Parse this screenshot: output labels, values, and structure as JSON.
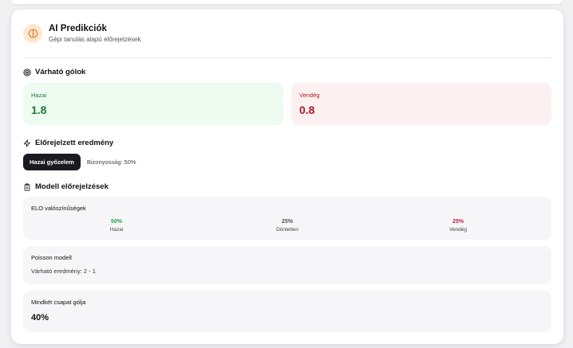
{
  "header": {
    "title": "AI Predikciók",
    "subtitle": "Gépi tanulás alapú előrejelzések",
    "icon": "brain-icon"
  },
  "expected_goals": {
    "title": "Várható gólok",
    "home_label": "Hazai",
    "home_value": "1.8",
    "away_label": "Vendég",
    "away_value": "0.8"
  },
  "predicted_result": {
    "title": "Előrejelzett eredmény",
    "outcome": "Hazai győzelem",
    "confidence": "Bizonyosság: 50%"
  },
  "model_predictions": {
    "title": "Modell előrejelzések",
    "elo": {
      "title": "ELO valószínűségek",
      "items": [
        {
          "pct": "50%",
          "label": "Hazai"
        },
        {
          "pct": "25%",
          "label": "Döntetlen"
        },
        {
          "pct": "25%",
          "label": "Vendég"
        }
      ]
    },
    "poisson": {
      "title": "Poisson modell",
      "text": "Várható eredmény: 2 - 1"
    },
    "btts": {
      "title": "Mindkét csapat gólja",
      "value": "40%"
    }
  },
  "colors": {
    "home": "#1c7a3b",
    "away": "#b0182a",
    "accent_bg": "#fde8d2"
  }
}
